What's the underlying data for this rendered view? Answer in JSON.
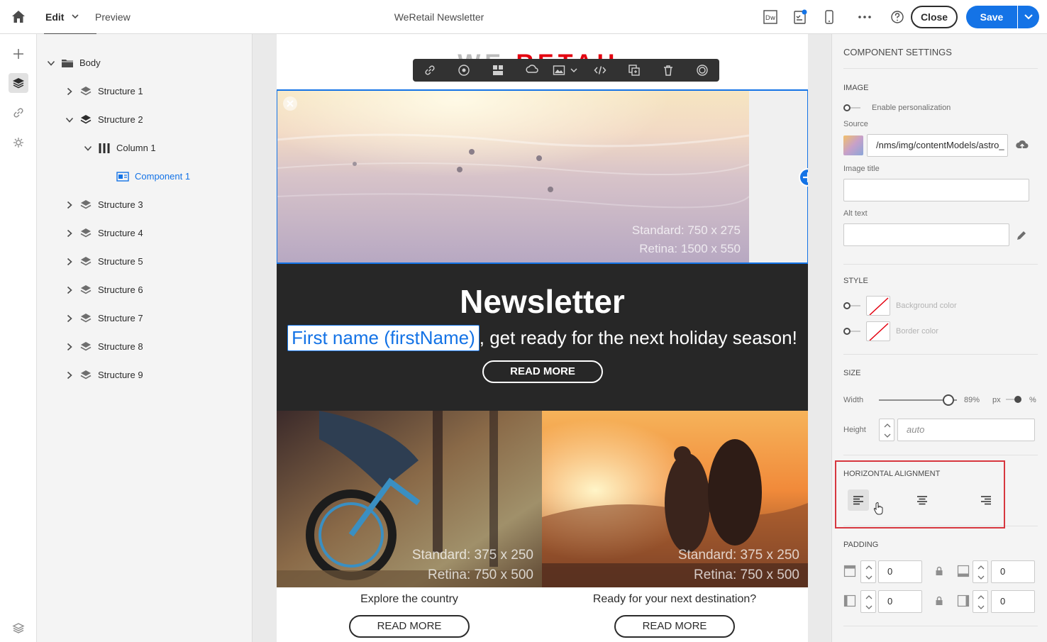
{
  "header": {
    "tab_edit": "Edit",
    "tab_preview": "Preview",
    "doc_title": "WeRetail Newsletter",
    "close_label": "Close",
    "save_label": "Save",
    "dw_label": "Dw"
  },
  "tree": {
    "body": "Body",
    "structure_1": "Structure 1",
    "structure_2": "Structure 2",
    "column_1": "Column 1",
    "component_1": "Component 1",
    "structure_3": "Structure 3",
    "structure_4": "Structure 4",
    "structure_5": "Structure 5",
    "structure_6": "Structure 6",
    "structure_7": "Structure 7",
    "structure_8": "Structure 8",
    "structure_9": "Structure 9"
  },
  "email": {
    "logo_we": "WE",
    "logo_retail": "RETAIL",
    "hero_standard": "Standard: 750 x 275",
    "hero_retina": "Retina: 1500 x 550",
    "title": "Newsletter",
    "firstname_chip": "First name (firstName)",
    "line_rest": ", get ready for the next holiday season!",
    "read_more": "READ MORE",
    "tile1_standard": "Standard: 375 x 250",
    "tile1_retina": "Retina: 750 x 500",
    "tile2_standard": "Standard: 375 x 250",
    "tile2_retina": "Retina: 750 x 500",
    "caption_1": "Explore the country",
    "caption_2": "Ready for your next destination?",
    "read_more_1": "READ MORE",
    "read_more_2": "READ MORE"
  },
  "settings": {
    "title": "COMPONENT SETTINGS",
    "image_head": "IMAGE",
    "enable_personalization": "Enable personalization",
    "source_label": "Source",
    "source_value": "/nms/img/contentModels/astro_",
    "image_title_label": "Image title",
    "alt_text_label": "Alt text",
    "style_head": "STYLE",
    "bg_color": "Background color",
    "border_color": "Border color",
    "size_head": "SIZE",
    "width_label": "Width",
    "width_value": "89%",
    "width_fraction": 0.89,
    "unit_px": "px",
    "unit_pct": "%",
    "height_label": "Height",
    "height_placeholder": "auto",
    "halign_head": "HORIZONTAL ALIGNMENT",
    "padding_head": "PADDING",
    "pad_top": "0",
    "pad_bottom": "0",
    "pad_left": "0",
    "pad_right": "0"
  },
  "colors": {
    "accent": "#1473e6",
    "highlight_box": "#d7373f",
    "logo_red": "#e3000f",
    "dark_band": "#272727"
  },
  "icons": [
    "home-icon",
    "chevron-down-icon",
    "dreamweaver-icon",
    "checklist-icon",
    "mobile-icon",
    "more-icon",
    "help-icon",
    "plus-icon",
    "layers-icon",
    "link-icon",
    "fragment-icon",
    "folder-icon",
    "column-icon",
    "image-component-icon",
    "trash-icon",
    "upload-icon",
    "pencil-icon",
    "lock-icon",
    "align-left-icon",
    "align-center-icon",
    "align-right-icon",
    "cursor-hand-icon"
  ]
}
